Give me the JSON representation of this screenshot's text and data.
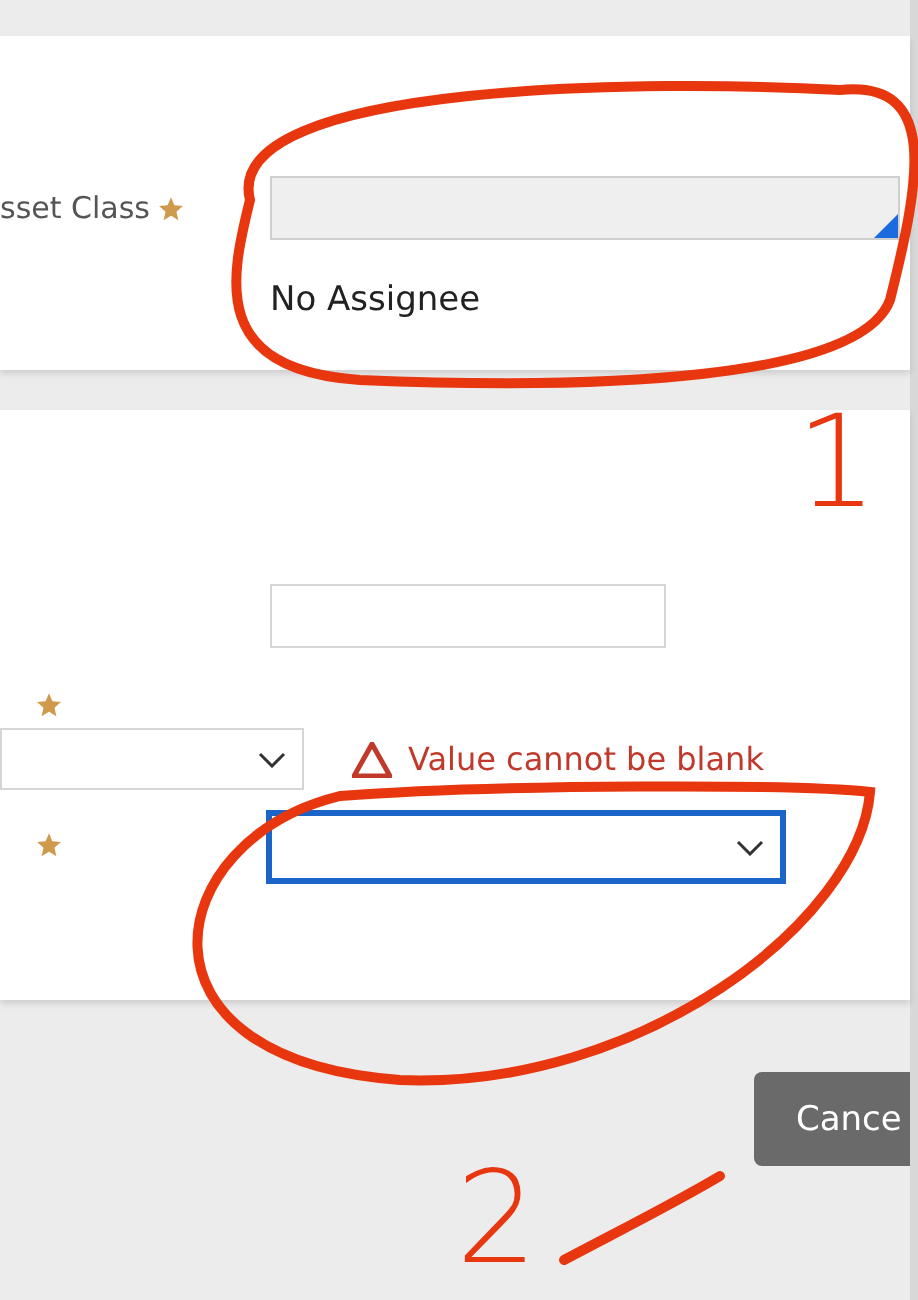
{
  "sections": [
    {
      "fields": [
        {
          "kind": "lookup",
          "label": "sset Class",
          "required": true,
          "value": "No Assignee"
        }
      ]
    },
    {
      "fields": [
        {
          "kind": "text",
          "required": false
        },
        {
          "kind": "select",
          "required": true,
          "focused": false,
          "error": "Value cannot be blank"
        },
        {
          "kind": "select",
          "required": true,
          "focused": true
        }
      ]
    }
  ],
  "buttons": [
    {
      "label": "Cance"
    }
  ],
  "annotations": [
    {
      "kind": "ring"
    },
    {
      "kind": "number",
      "text": "1"
    },
    {
      "kind": "ring"
    },
    {
      "kind": "number",
      "text": "2"
    }
  ]
}
